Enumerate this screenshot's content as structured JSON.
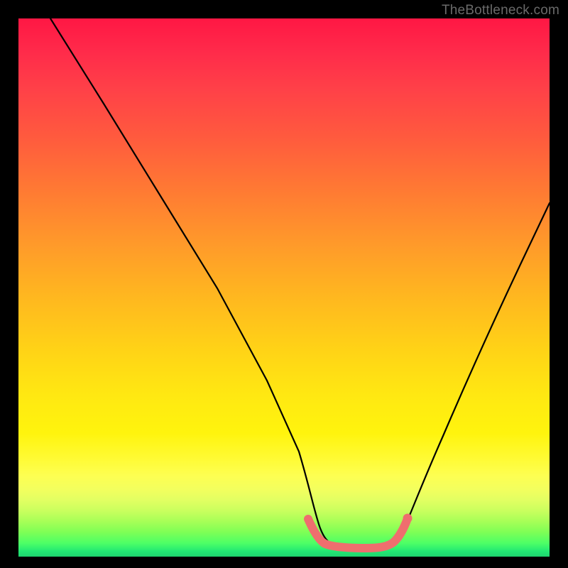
{
  "attribution": "TheBottleneck.com",
  "colors": {
    "frame": "#000000",
    "curve_stroke": "#000000",
    "marker": "#ef6e6e",
    "gradient_top": "#ff1744",
    "gradient_bottom": "#1ed36e"
  },
  "chart_data": {
    "type": "line",
    "title": "",
    "xlabel": "",
    "ylabel": "",
    "xlim": [
      0,
      100
    ],
    "ylim": [
      0,
      100
    ],
    "legend": false,
    "grid": false,
    "series": [
      {
        "name": "bottleneck-curve",
        "x": [
          6,
          10,
          15,
          20,
          25,
          30,
          35,
          40,
          45,
          50,
          52,
          54,
          56,
          58,
          60,
          62,
          64,
          66,
          68,
          70,
          75,
          80,
          85,
          90,
          95,
          100
        ],
        "values": [
          100,
          92,
          82,
          72,
          62,
          52,
          43,
          34,
          25,
          17,
          12,
          8,
          4,
          1.5,
          0.5,
          0,
          0,
          0.5,
          2,
          5,
          15,
          27,
          40,
          53,
          66,
          78
        ]
      }
    ],
    "marker_region": {
      "x_start": 54,
      "x_end": 70,
      "note": "flat-bottom highlighted span"
    }
  }
}
